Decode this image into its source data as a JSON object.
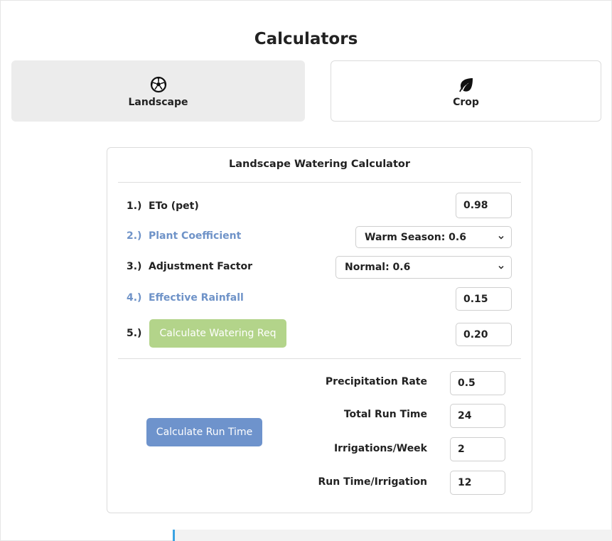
{
  "page": {
    "title": "Calculators"
  },
  "tabs": [
    {
      "label": "Landscape",
      "icon": "soccer-ball-icon",
      "active": true
    },
    {
      "label": "Crop",
      "icon": "leaf-icon",
      "active": false
    }
  ],
  "calculator": {
    "title": "Landscape Watering Calculator",
    "rows": [
      {
        "num": "1.)",
        "label": "ETo (pet)",
        "value": "0.98"
      },
      {
        "num": "2.)",
        "label": "Plant Coefficient",
        "selected": "Warm Season: 0.6"
      },
      {
        "num": "3.)",
        "label": "Adjustment Factor",
        "selected": "Normal: 0.6"
      },
      {
        "num": "4.)",
        "label": "Effective Rainfall",
        "value": "0.15"
      },
      {
        "num": "5.)",
        "button": "Calculate Watering Req",
        "value": "0.20"
      }
    ],
    "runtime": {
      "button": "Calculate Run Time",
      "fields": [
        {
          "label": "Precipitation Rate",
          "value": "0.5"
        },
        {
          "label": "Total Run Time",
          "value": "24"
        },
        {
          "label": "Irrigations/Week",
          "value": "2"
        },
        {
          "label": "Run Time/Irrigation",
          "value": "12"
        }
      ]
    }
  },
  "colors": {
    "muted_label": "#6f93c8",
    "green_button": "#b3d48a",
    "blue_button": "#6e93cc",
    "accent": "#3aa3e3"
  }
}
